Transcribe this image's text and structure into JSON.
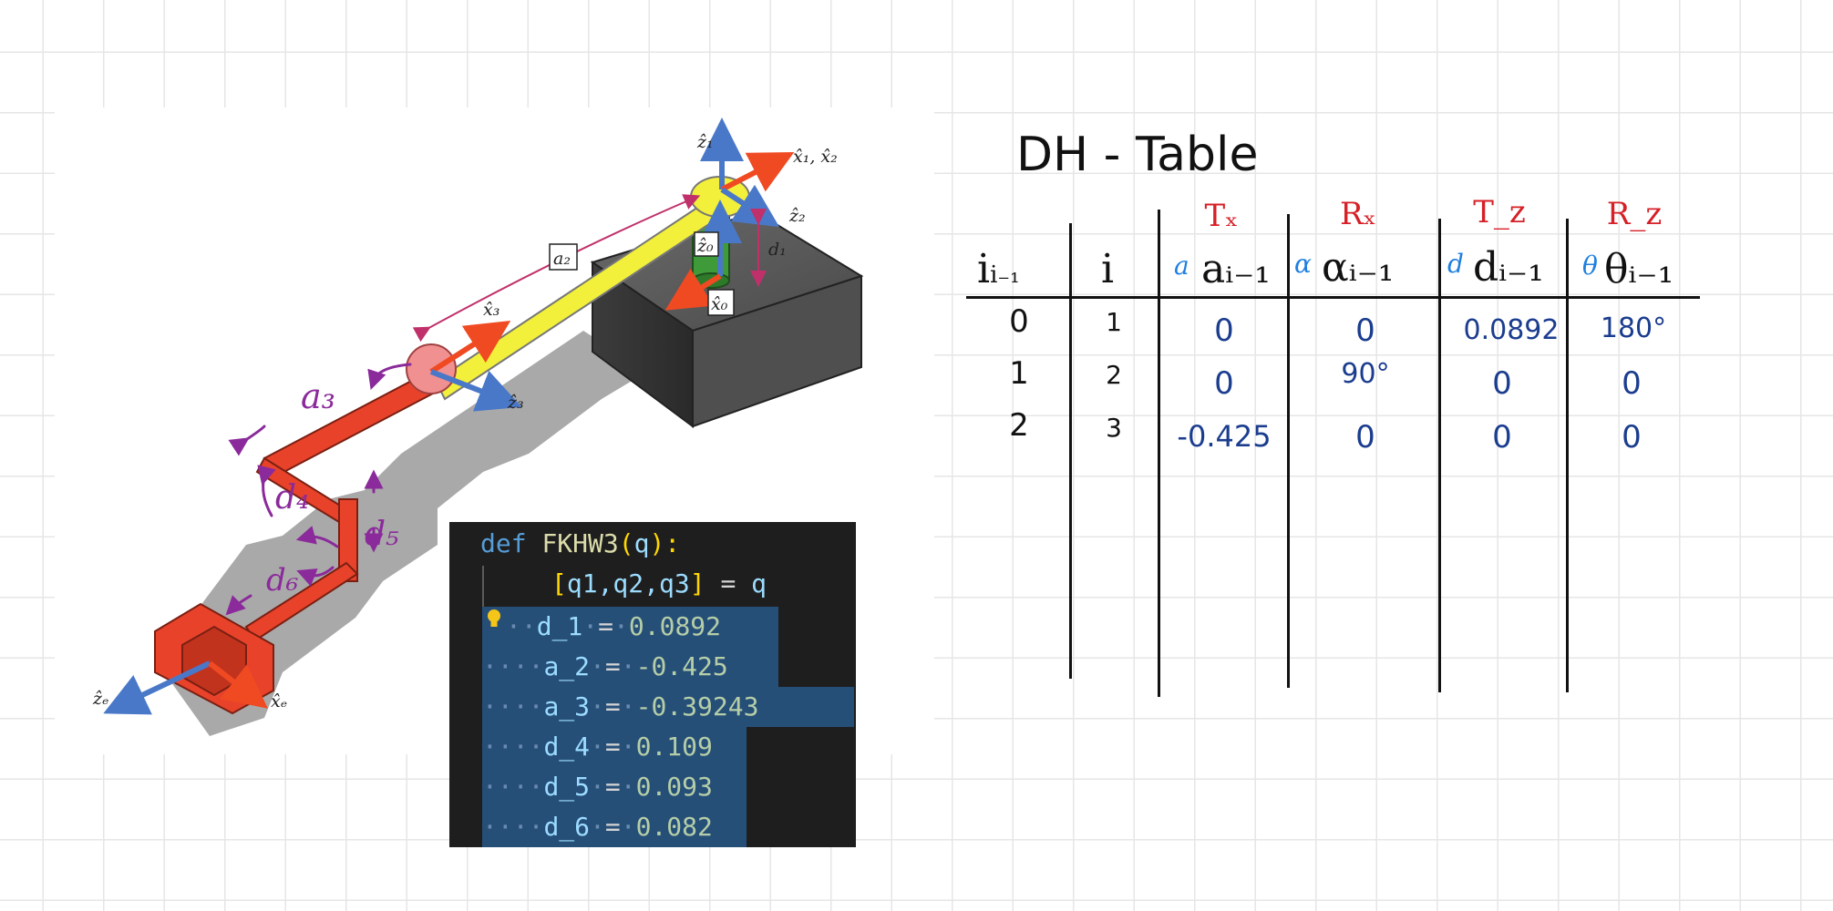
{
  "figure": {
    "axis_labels": {
      "z1": "ẑ₁",
      "x1x2": "x̂₁, x̂₂",
      "z2": "ẑ₂",
      "z0": "ẑ₀",
      "x0": "x̂₀",
      "d1": "d₁",
      "a2": "a₂",
      "x3": "x̂₃",
      "z3": "ẑ₃",
      "ze": "ẑₑ",
      "xe": "x̂ₑ"
    },
    "handwritten": {
      "a3": "a₃",
      "d4": "d₄",
      "d5": "d₅",
      "d6": "d₆"
    }
  },
  "code": {
    "def_kw": "def",
    "fn_name": "FKHW3",
    "param": "q",
    "unpack_vars": "q1,q2,q3",
    "unpack_src": "q",
    "params": [
      {
        "name": "d_1",
        "value": "0.0892"
      },
      {
        "name": "a_2",
        "value": "-0.425"
      },
      {
        "name": "a_3",
        "value": "-0.39243"
      },
      {
        "name": "d_4",
        "value": "0.109"
      },
      {
        "name": "d_5",
        "value": "0.093"
      },
      {
        "name": "d_6",
        "value": "0.082"
      }
    ]
  },
  "dh_table": {
    "title": "DH - Table",
    "col_i_minus_1": "i₋₁",
    "col_i": "i",
    "groups": [
      {
        "op": "Tₓ",
        "sym": "a",
        "var": "aᵢ₋₁"
      },
      {
        "op": "Rₓ",
        "sym": "α",
        "var": "αᵢ₋₁"
      },
      {
        "op": "T_z",
        "sym": "d",
        "var": "dᵢ₋₁"
      },
      {
        "op": "R_z",
        "sym": "θ",
        "var": "θᵢ₋₁"
      }
    ],
    "rows": [
      {
        "i_minus_1": "0",
        "i": "1",
        "a": "0",
        "alpha": "0",
        "d": "0.0892",
        "theta": "180°"
      },
      {
        "i_minus_1": "1",
        "i": "2",
        "a": "0",
        "alpha": "90°",
        "d": "0",
        "theta": "0"
      },
      {
        "i_minus_1": "2",
        "i": "3",
        "a": "-0.425",
        "alpha": "0",
        "d": "0",
        "theta": "0"
      }
    ]
  },
  "colors": {
    "grid": "#e6e6e6",
    "header_red": "#d61f26",
    "header_blue": "#1f7fe0",
    "value_blue": "#1b3d8f",
    "handwriting_purple": "#8b2a9b",
    "editor_bg": "#1e1e1e",
    "editor_selection": "#264f78"
  }
}
